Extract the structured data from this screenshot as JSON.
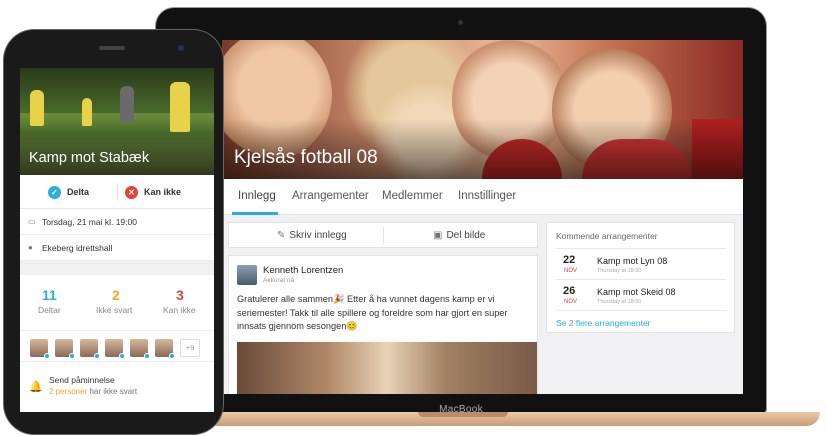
{
  "laptop": {
    "brand": "MacBook",
    "hero_title": "Kjelsås fotball 08",
    "tabs": [
      "Innlegg",
      "Arrangementer",
      "Medlemmer",
      "Innstillinger"
    ],
    "compose": {
      "write_label": "Skriv innlegg",
      "share_photo_label": "Del bilde"
    },
    "post": {
      "author": "Kenneth Lorentzen",
      "time": "Akkurat nå",
      "text": "Gratulerer alle sammen🎉 Etter å ha vunnet dagens kamp er vi seriemester! Takk til alle spillere og foreldre som har gjort en super innsats gjennom sesongen😊"
    },
    "upcoming": {
      "title": "Kommende arrangementer",
      "events": [
        {
          "day": "22",
          "month": "NOV",
          "name": "Kamp mot Lyn 08",
          "when": "Thursday at 18:00"
        },
        {
          "day": "26",
          "month": "NOV",
          "name": "Kamp mot Skeid 08",
          "when": "Thursday at 18:00"
        }
      ],
      "more_link": "Se 2 flere arrangementer"
    }
  },
  "phone": {
    "hero_title": "Kamp mot Stabæk",
    "rsvp": {
      "yes_label": "Delta",
      "no_label": "Kan ikke"
    },
    "date": "Torsdag, 21 mai kl. 19:00",
    "location": "Ekeberg idrettshall",
    "stats": [
      {
        "count": "11",
        "label": "Deltar",
        "color": "#29aee0"
      },
      {
        "count": "2",
        "label": "Ikke svart",
        "color": "#f5a623"
      },
      {
        "count": "3",
        "label": "Kan ikke",
        "color": "#e0463c"
      }
    ],
    "avatars_more": "+9",
    "reminder": {
      "title": "Send påminnelse",
      "sub_highlight": "2 personer",
      "sub_rest": " har ikke svart"
    }
  },
  "colors": {
    "accent": "#29aee0",
    "warning": "#f5a623",
    "danger": "#e0463c"
  }
}
